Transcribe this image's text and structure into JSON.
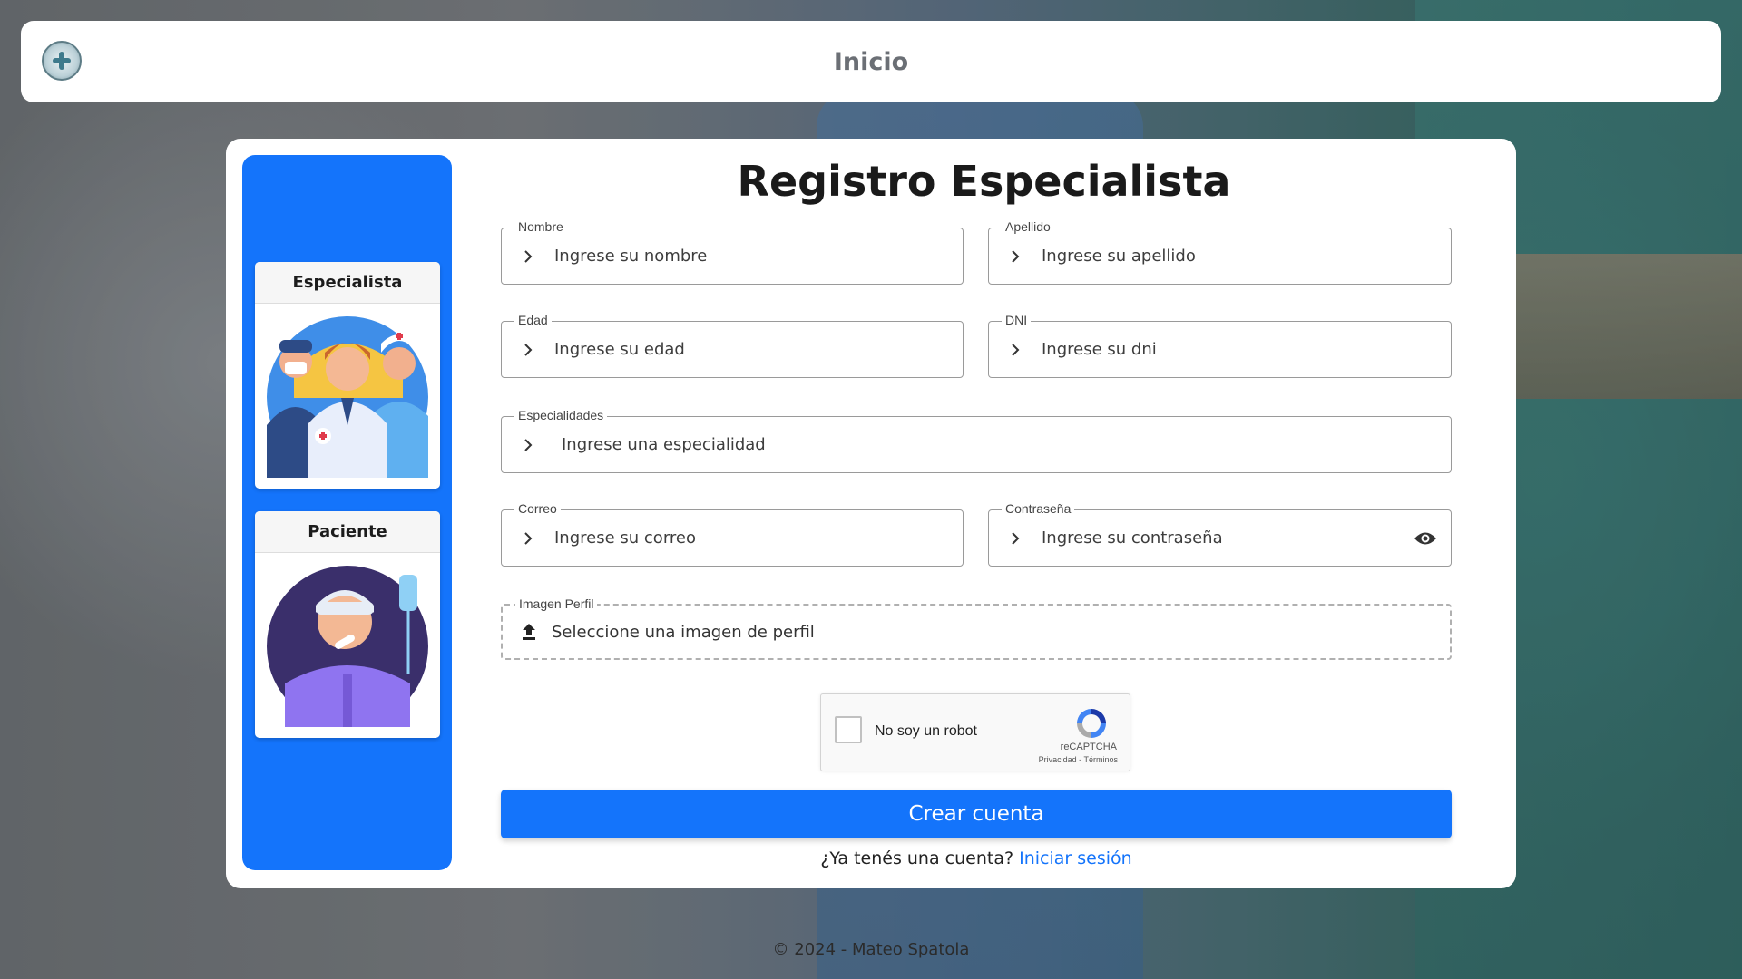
{
  "navbar": {
    "title": "Inicio"
  },
  "sidebar": {
    "roles": [
      {
        "label": "Especialista"
      },
      {
        "label": "Paciente"
      }
    ]
  },
  "form": {
    "title": "Registro Especialista",
    "fields": {
      "nombre": {
        "label": "Nombre",
        "placeholder": "Ingrese su nombre"
      },
      "apellido": {
        "label": "Apellido",
        "placeholder": "Ingrese su apellido"
      },
      "edad": {
        "label": "Edad",
        "placeholder": "Ingrese su edad"
      },
      "dni": {
        "label": "DNI",
        "placeholder": "Ingrese su dni"
      },
      "especialidades": {
        "label": "Especialidades",
        "placeholder": "Ingrese una especialidad"
      },
      "correo": {
        "label": "Correo",
        "placeholder": "Ingrese su correo"
      },
      "contrasena": {
        "label": "Contraseña",
        "placeholder": "Ingrese su contraseña"
      },
      "imagen": {
        "label": "Imagen Perfil",
        "text": "Seleccione una imagen de perfil"
      }
    },
    "captcha": {
      "text": "No soy un robot",
      "brand": "reCAPTCHA",
      "links": "Privacidad - Términos"
    },
    "submit_label": "Crear cuenta",
    "login_prompt": "¿Ya tenés una cuenta?",
    "login_link": "Iniciar sesión"
  },
  "footer": {
    "text": "© 2024 - Mateo Spatola"
  },
  "colors": {
    "primary": "#1474fb"
  },
  "icons": {
    "field": "chevron-right-icon",
    "upload": "upload-icon",
    "password": "eye-icon"
  }
}
